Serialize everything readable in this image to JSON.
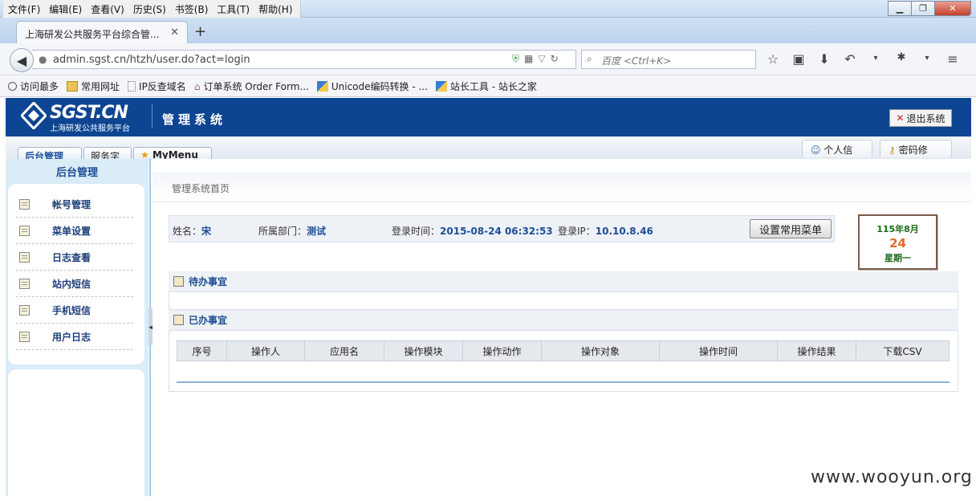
{
  "menubar": {
    "items": [
      "文件(F)",
      "编辑(E)",
      "查看(V)",
      "历史(S)",
      "书签(B)",
      "工具(T)",
      "帮助(H)"
    ]
  },
  "tab": {
    "title": "上海研发公共服务平台综合管..."
  },
  "navbar": {
    "url": "admin.sgst.cn/htzh/user.do?act=login",
    "search_placeholder": "百度 <Ctrl+K>"
  },
  "bookmarks": [
    "访问最多",
    "常用网址",
    "IP反查域名",
    "订单系统 Order Form...",
    "Unicode编码转换 - ...",
    "站长工具 - 站长之家"
  ],
  "header": {
    "logo_text": "SGST.CN",
    "logo_subtitle": "上海研发公共服务平台",
    "system_title": "管理系统",
    "logout_label": "退出系统"
  },
  "page_tabs": [
    "后台管理",
    "服务字",
    "MyMenu"
  ],
  "right_tabs": [
    "个人信",
    "密码修"
  ],
  "sidebar": {
    "title": "后台管理",
    "items": [
      "帐号管理",
      "菜单设置",
      "日志查看",
      "站内短信",
      "手机短信",
      "用户日志"
    ]
  },
  "breadcrumb": "管理系统首页",
  "info": {
    "name_label": "姓名：",
    "name": "宋",
    "dept_label": "所属部门：",
    "dept": "测试",
    "login_time_label": "登录时间：",
    "login_time": "2015-08-24 06:32:53",
    "login_ip_label": "登录IP：",
    "login_ip": "10.10.8.46",
    "set_menu_button": "设置常用菜单"
  },
  "calendar": {
    "year_month": "115年8月",
    "day": "24",
    "weekday": "星期一"
  },
  "sections": {
    "todo": "待办事宜",
    "done": "已办事宜"
  },
  "table": {
    "columns": [
      "序号",
      "操作人",
      "应用名",
      "操作模块",
      "操作动作",
      "操作对象",
      "操作时间",
      "操作结果",
      "下载CSV"
    ]
  },
  "watermark": "www.wooyun.org",
  "colors": {
    "header_bg": "#0d4592",
    "sidebar_bg": "#d9ecf7",
    "accent_text": "#1d4e96"
  }
}
